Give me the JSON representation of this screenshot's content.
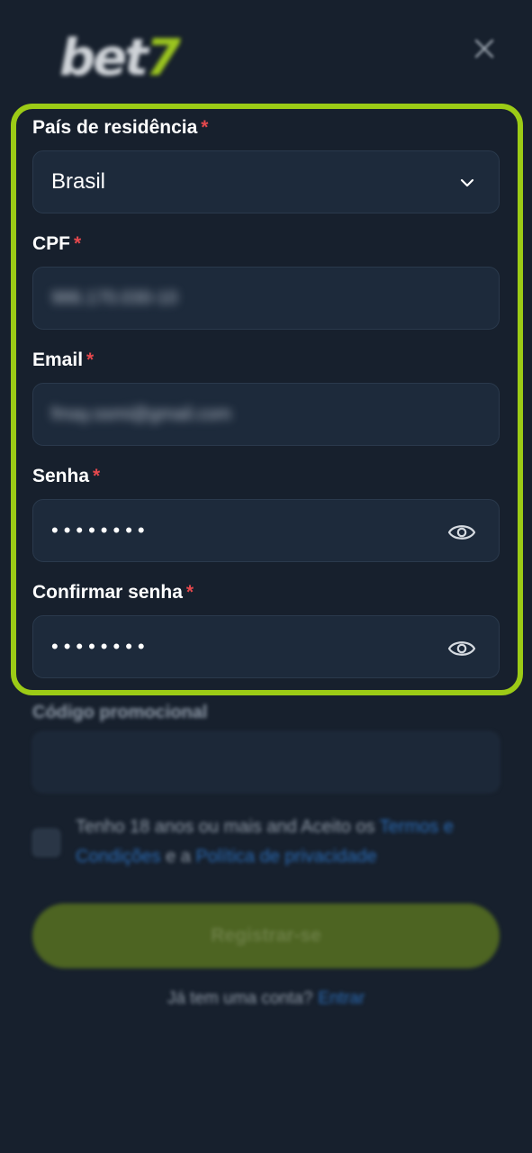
{
  "header": {
    "logo_main": "bet",
    "logo_accent": "7",
    "close_icon": "close-icon"
  },
  "form": {
    "country": {
      "label": "País de residência",
      "required": "*",
      "value": "Brasil",
      "icon": "chevron-down-icon"
    },
    "cpf": {
      "label": "CPF",
      "required": "*",
      "value": "986.170.030-10"
    },
    "email": {
      "label": "Email",
      "required": "*",
      "value": "fmay.ssmi@gmail.com"
    },
    "password": {
      "label": "Senha",
      "required": "*",
      "value": "••••••••",
      "icon": "eye-icon"
    },
    "confirm_password": {
      "label": "Confirmar senha",
      "required": "*",
      "value": "••••••••",
      "icon": "eye-icon"
    },
    "promo": {
      "label": "Código promocional",
      "value": ""
    }
  },
  "terms": {
    "prefix": "Tenho 18 anos ou mais and Aceito os ",
    "terms_link": "Termos e Condições",
    "middle": " e a ",
    "privacy_link": "Política de privacidade"
  },
  "register_button": "Registrar-se",
  "login": {
    "prompt": "Já tem uma conta?",
    "link": "Entrar"
  },
  "colors": {
    "background": "#17202d",
    "highlight": "#9ccb16",
    "required": "#e5484d",
    "link": "#2a6bb5",
    "button": "#4d6422"
  }
}
